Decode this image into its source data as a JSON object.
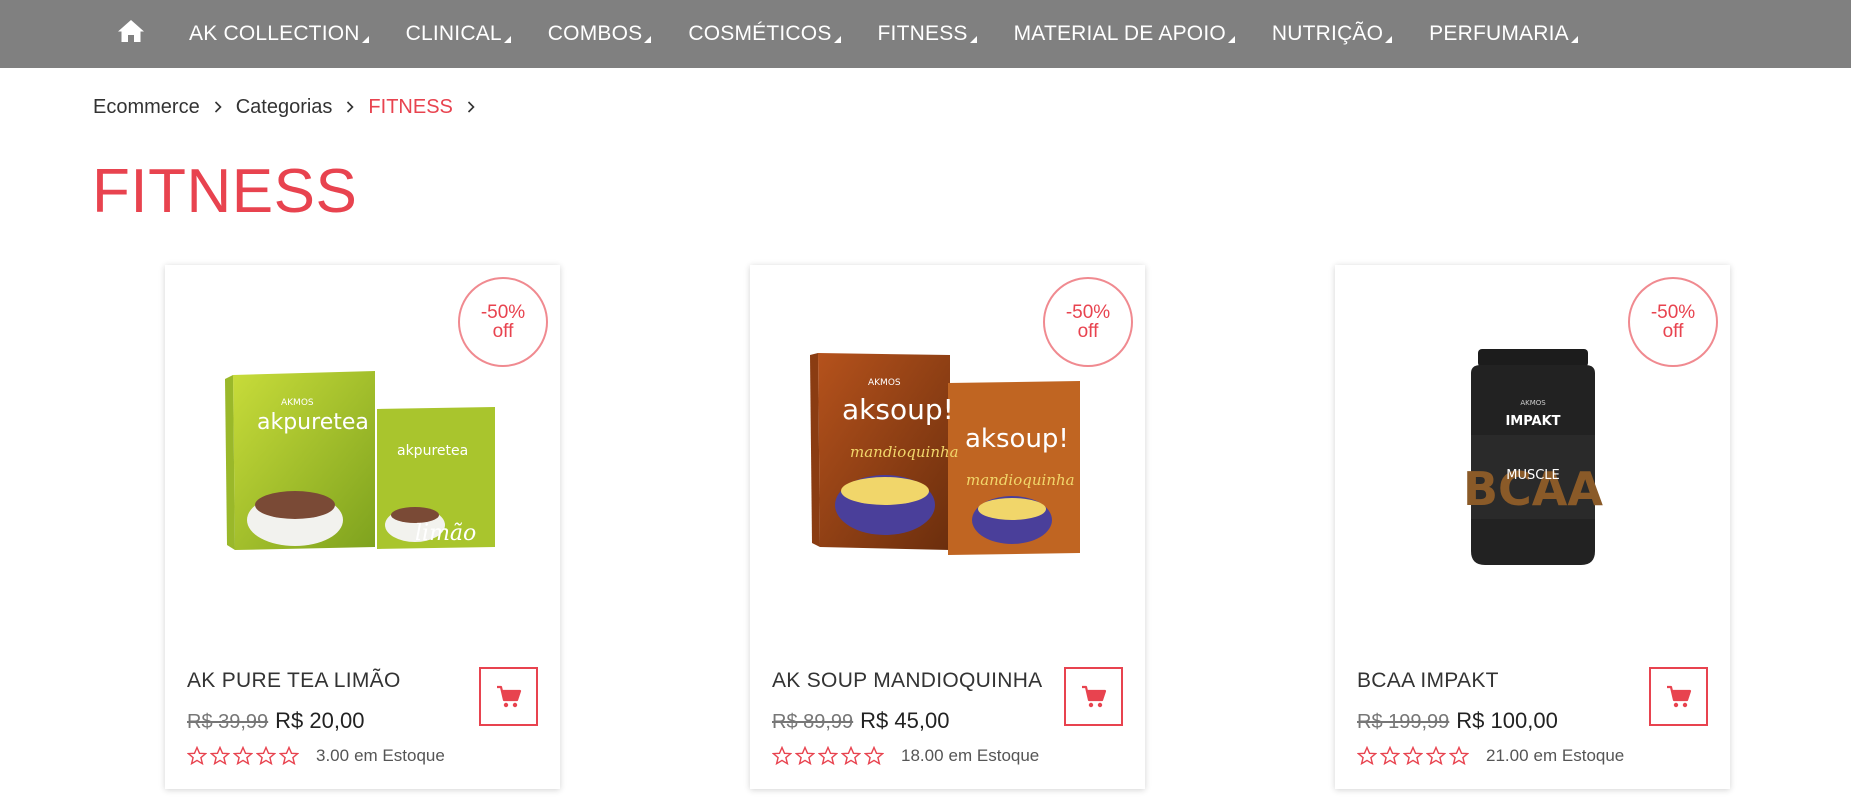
{
  "colors": {
    "accent": "#e8434f",
    "nav_bg": "#808080",
    "badge_border": "#f08a90"
  },
  "nav": {
    "home_icon": "home-icon",
    "items": [
      {
        "label": "AK COLLECTION"
      },
      {
        "label": "CLINICAL"
      },
      {
        "label": "COMBOS"
      },
      {
        "label": "COSMÉTICOS"
      },
      {
        "label": "FITNESS"
      },
      {
        "label": "MATERIAL DE APOIO"
      },
      {
        "label": "NUTRIÇÃO"
      },
      {
        "label": "PERFUMARIA"
      }
    ]
  },
  "breadcrumb": {
    "items": [
      "Ecommerce",
      "Categorias",
      "FITNESS"
    ]
  },
  "page": {
    "title": "FITNESS"
  },
  "products": [
    {
      "discount": "-50%",
      "discount_suffix": "off",
      "name": "AK PURE TEA LIMÃO",
      "old_price": "R$ 39,99",
      "new_price": "R$ 20,00",
      "rating": 0,
      "rating_max": 5,
      "stock_qty": "3.00",
      "stock_label": "em Estoque",
      "image_brand": "akpuretea",
      "image_flavor": "limão",
      "image_maker": "AKMOS"
    },
    {
      "discount": "-50%",
      "discount_suffix": "off",
      "name": "AK SOUP MANDIOQUINHA",
      "old_price": "R$ 89,99",
      "new_price": "R$ 45,00",
      "rating": 0,
      "rating_max": 5,
      "stock_qty": "18.00",
      "stock_label": "em Estoque",
      "image_brand": "aksoup!",
      "image_flavor": "mandioquinha",
      "image_maker": "AKMOS"
    },
    {
      "discount": "-50%",
      "discount_suffix": "off",
      "name": "BCAA IMPAKT",
      "old_price": "R$ 199,99",
      "new_price": "R$ 100,00",
      "rating": 0,
      "rating_max": 5,
      "stock_qty": "21.00",
      "stock_label": "em Estoque",
      "image_brand": "IMPAKT",
      "image_flavor": "MUSCLE",
      "image_maker": "AKMOS"
    }
  ]
}
